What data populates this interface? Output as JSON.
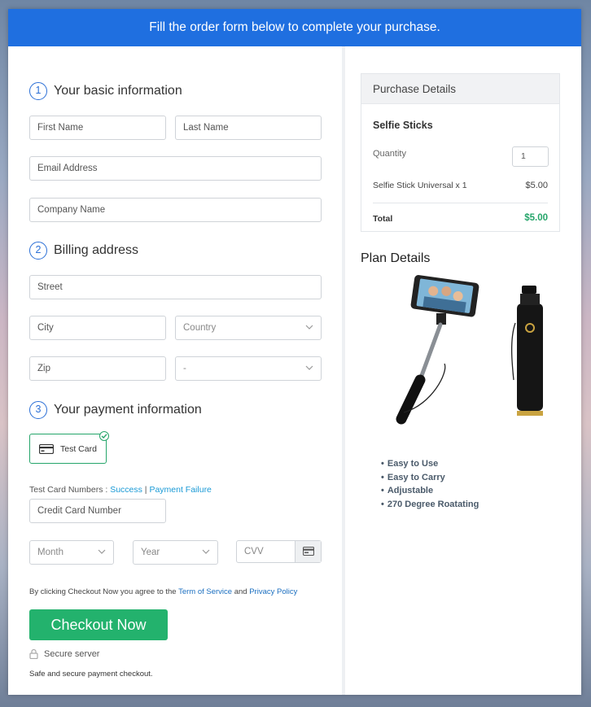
{
  "banner": {
    "text": "Fill the order form below to complete your purchase."
  },
  "basic": {
    "number": "1",
    "title": "Your basic information",
    "first_name": "First Name",
    "last_name": "Last Name",
    "email": "Email Address",
    "company": "Company Name"
  },
  "billing": {
    "number": "2",
    "title": "Billing address",
    "street": "Street",
    "city": "City",
    "country": "Country",
    "zip": "Zip",
    "state": "-"
  },
  "payment": {
    "number": "3",
    "title": "Your payment information",
    "test_card_label": "Test Card",
    "test_numbers_prefix": "Test Card Numbers : ",
    "success_link": "Success",
    "separator": " | ",
    "failure_link": "Payment Failure",
    "card_number": "Credit Card Number",
    "month": "Month",
    "year": "Year",
    "cvv": "CVV"
  },
  "agreement": {
    "prefix": "By clicking Checkout Now you agree to the ",
    "terms": "Term of Service",
    "and": " and ",
    "privacy": "Privacy Policy"
  },
  "checkout": {
    "button": "Checkout Now",
    "secure": "Secure server",
    "safe": "Safe and secure payment checkout."
  },
  "purchase": {
    "header": "Purchase Details",
    "product": "Selfie Sticks",
    "quantity_label": "Quantity",
    "quantity": "1",
    "item": "Selfie Stick Universal x 1",
    "item_price": "$5.00",
    "total_label": "Total",
    "total": "$5.00",
    "total_color": "#25a56a"
  },
  "plan": {
    "title": "Plan Details",
    "features": [
      "Easy to Use",
      "Easy to Carry",
      "Adjustable",
      "270 Degree Roatating"
    ]
  },
  "colors": {
    "banner": "#1f6fe0",
    "accent": "#2b6fd6",
    "checkout": "#23b26d"
  }
}
